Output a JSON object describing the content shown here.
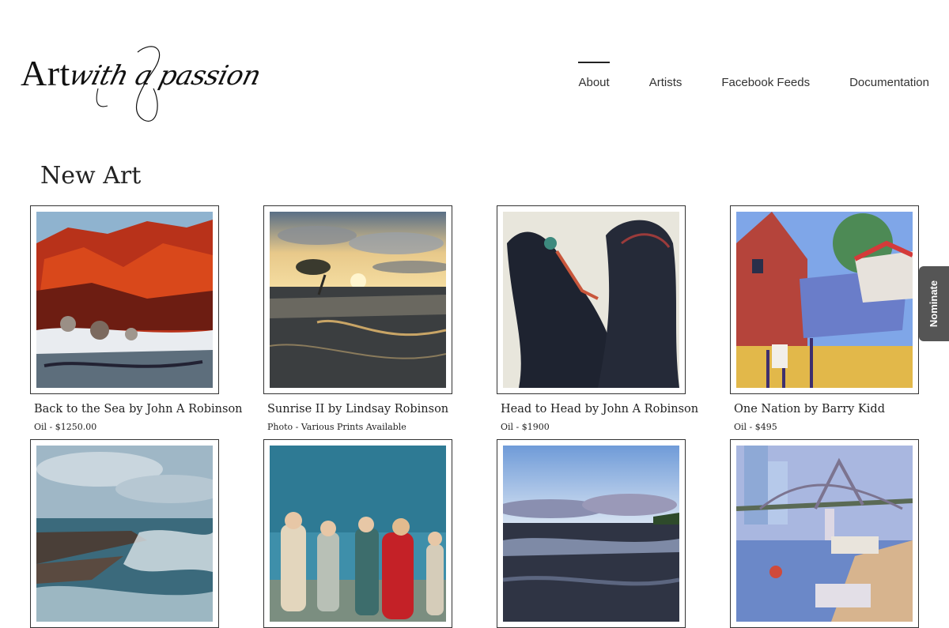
{
  "header": {
    "logo": {
      "word1": "Art",
      "word2": "with a passion"
    },
    "nav": [
      {
        "label": "About",
        "active": true
      },
      {
        "label": "Artists",
        "active": false
      },
      {
        "label": "Facebook Feeds",
        "active": false
      },
      {
        "label": "Documentation",
        "active": false
      }
    ]
  },
  "main": {
    "title": "New Art",
    "artworks": [
      {
        "title": "Back to the Sea by John A Robinson",
        "detail": "Oil - $1250.00"
      },
      {
        "title": "Sunrise II by Lindsay Robinson",
        "detail": "Photo - Various Prints Available"
      },
      {
        "title": "Head to Head by John A Robinson",
        "detail": "Oil - $1900"
      },
      {
        "title": "One Nation by Barry Kidd",
        "detail": "Oil - $495"
      },
      {
        "title": "",
        "detail": ""
      },
      {
        "title": "",
        "detail": ""
      },
      {
        "title": "",
        "detail": ""
      },
      {
        "title": "",
        "detail": ""
      }
    ]
  },
  "sidebar_tab": {
    "label": "Nominate"
  },
  "colors": {
    "nominate_bg": "#555555",
    "frame_border": "#333333"
  }
}
